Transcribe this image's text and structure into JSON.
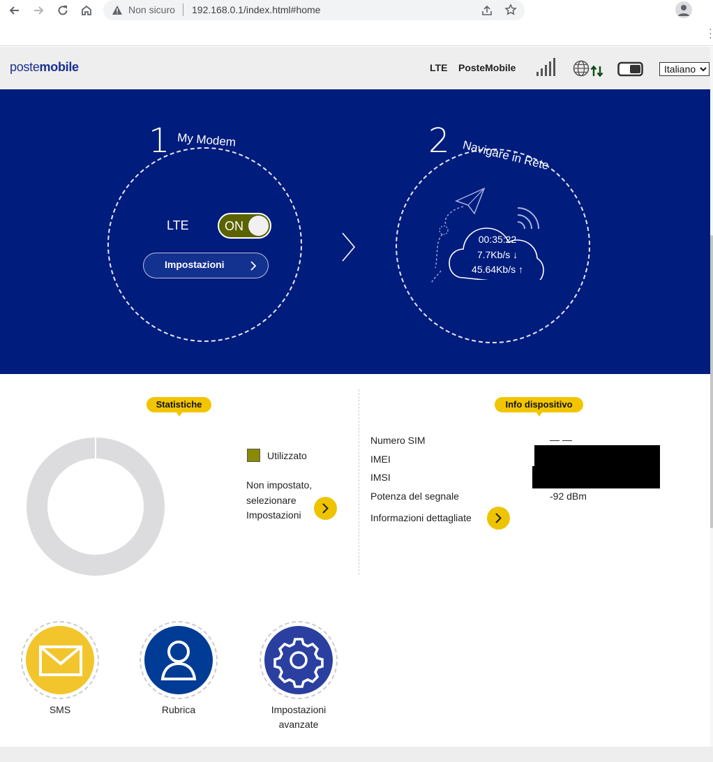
{
  "browser": {
    "security_warning": "Non sicuro",
    "url": "192.168.0.1/index.html#home"
  },
  "header": {
    "logo_prefix": "poste",
    "logo_suffix": "mobile",
    "network_type": "LTE",
    "operator": "PosteMobile",
    "language": "Italiano",
    "language_options": [
      "Italiano"
    ]
  },
  "hero": {
    "step1_number": "1",
    "step1_title": "My Modem",
    "step2_number": "2",
    "step2_title": "Navigare in Rete",
    "lte_label": "LTE",
    "toggle_state": "ON",
    "settings_button": "Impostazioni",
    "connection_time": "00:35:22",
    "download_speed": "7.7Kb/s ↓",
    "upload_speed": "45.64Kb/s ↑"
  },
  "statistics": {
    "title": "Statistiche",
    "legend_used": "Utilizzato",
    "message": "Non impostato, selezionare Impostazioni",
    "used_fraction": 0
  },
  "device_info": {
    "title": "Info dispositivo",
    "rows": [
      {
        "label": "Numero SIM",
        "value": "— —"
      },
      {
        "label": "IMEI",
        "value": ""
      },
      {
        "label": "IMSI",
        "value": ""
      },
      {
        "label": "Potenza del segnale",
        "value": "-92 dBm"
      }
    ],
    "details_link": "Informazioni dettagliate"
  },
  "shortcuts": [
    {
      "label": "SMS",
      "color": "#f2c52d"
    },
    {
      "label": "Rubrica",
      "color": "#003c96"
    },
    {
      "label": "Impostazioni avanzate",
      "color": "#2a3fa0"
    }
  ],
  "colors": {
    "brand_blue": "#001c7d",
    "accent_yellow": "#f2c500",
    "toggle_olive": "#5a6300"
  }
}
